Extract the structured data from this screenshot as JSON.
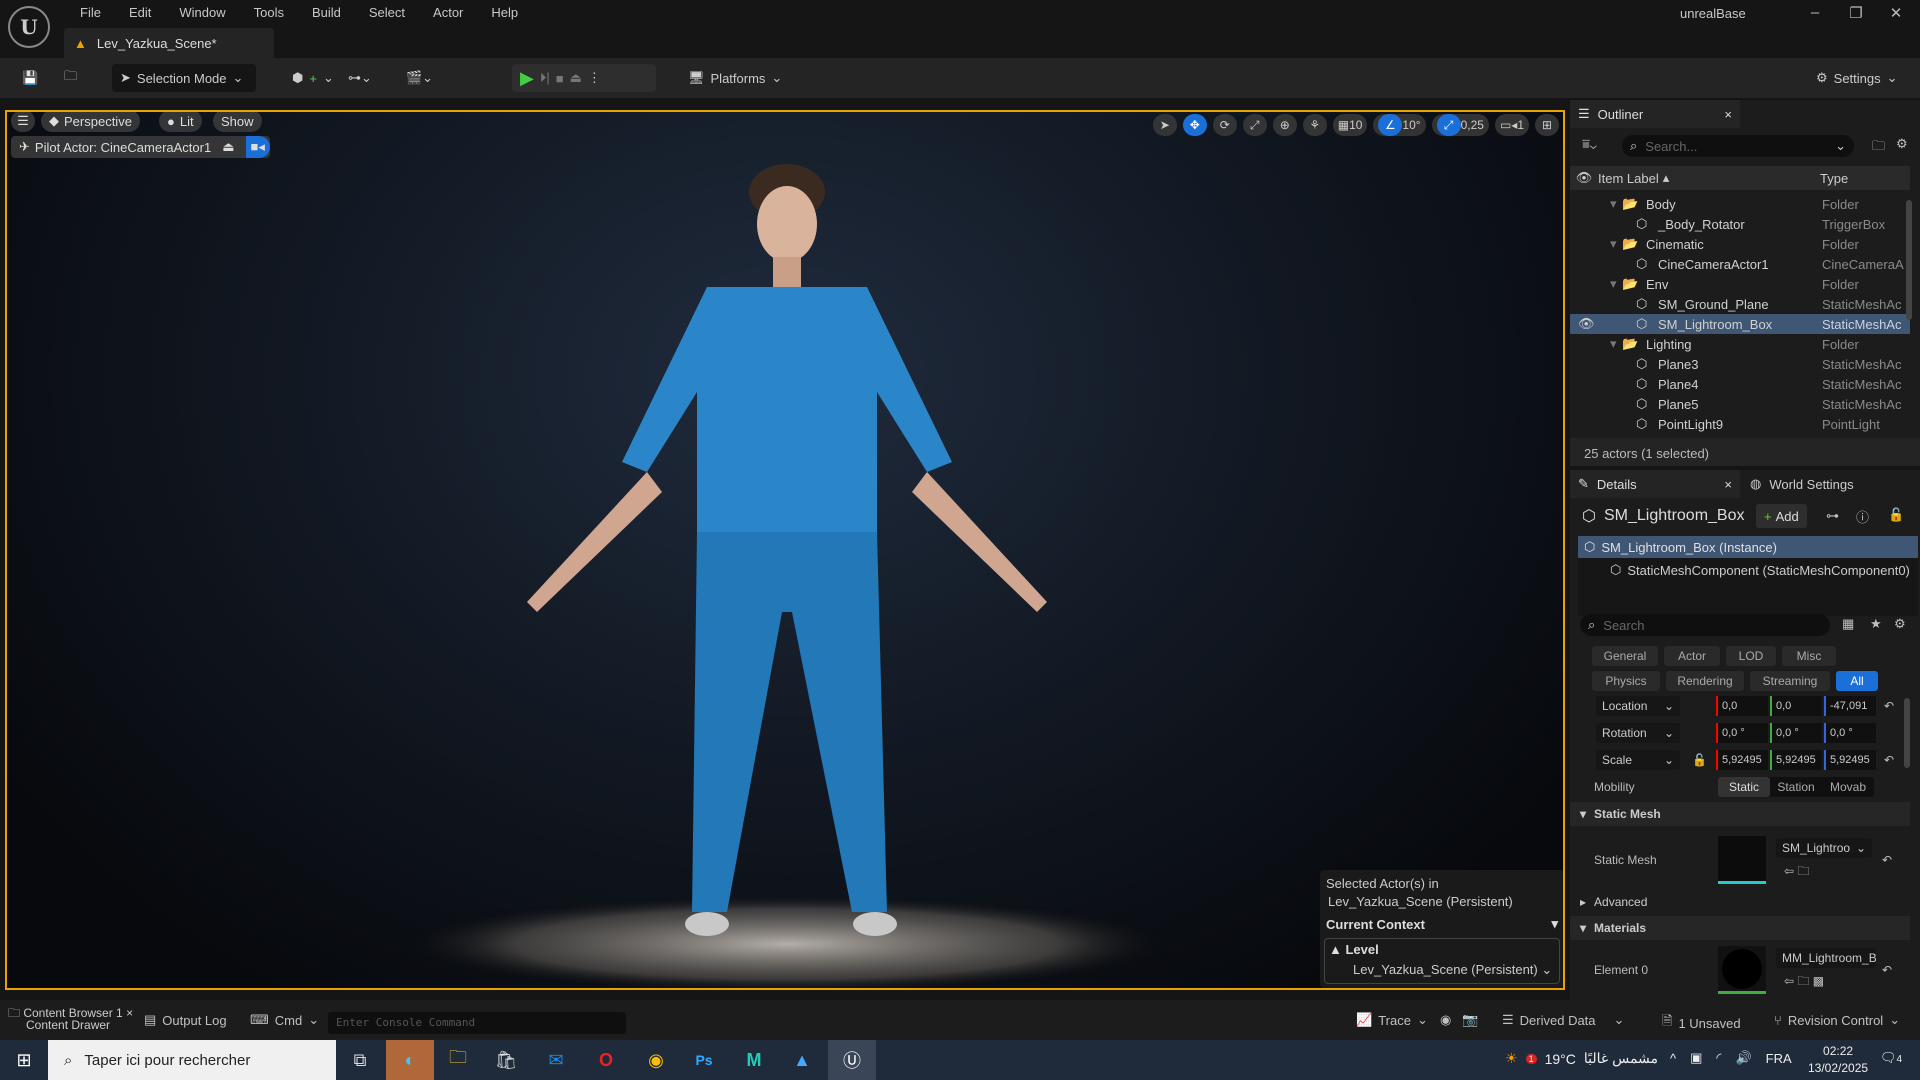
{
  "app": {
    "title": "unrealBase",
    "level_tab": "Lev_Yazkua_Scene*"
  },
  "menu": [
    "File",
    "Edit",
    "Window",
    "Tools",
    "Build",
    "Select",
    "Actor",
    "Help"
  ],
  "toolbar": {
    "selection_mode": "Selection Mode",
    "platforms": "Platforms",
    "settings": "Settings"
  },
  "viewport": {
    "perspective": "Perspective",
    "lit": "Lit",
    "show": "Show",
    "pilot": "Pilot Actor: CineCameraActor1",
    "grid_snap": "10",
    "rot_snap": "10°",
    "scale_snap": "0,25",
    "cam_speed": "1",
    "context": {
      "selected": "Selected Actor(s) in",
      "level_persistent": "Lev_Yazkua_Scene (Persistent)",
      "current_context": "Current Context",
      "level": "Level",
      "level_dropdown": "Lev_Yazkua_Scene (Persistent)"
    }
  },
  "outliner": {
    "tab": "Outliner",
    "search_placeholder": "Search...",
    "col_label": "Item Label",
    "col_type": "Type",
    "footer": "25 actors (1 selected)",
    "rows": [
      {
        "label": "Body",
        "type": "Folder",
        "folder": true
      },
      {
        "label": "_Body_Rotator",
        "type": "TriggerBox"
      },
      {
        "label": "Cinematic",
        "type": "Folder",
        "folder": true
      },
      {
        "label": "CineCameraActor1",
        "type": "CineCameraA"
      },
      {
        "label": "Env",
        "type": "Folder",
        "folder": true
      },
      {
        "label": "SM_Ground_Plane",
        "type": "StaticMeshAc"
      },
      {
        "label": "SM_Lightroom_Box",
        "type": "StaticMeshAc",
        "selected": true
      },
      {
        "label": "Lighting",
        "type": "Folder",
        "folder": true
      },
      {
        "label": "Plane3",
        "type": "StaticMeshAc"
      },
      {
        "label": "Plane4",
        "type": "StaticMeshAc"
      },
      {
        "label": "Plane5",
        "type": "StaticMeshAc"
      },
      {
        "label": "PointLight9",
        "type": "PointLight"
      }
    ]
  },
  "details": {
    "tab": "Details",
    "world_tab": "World Settings",
    "actor": "SM_Lightroom_Box",
    "add": "Add",
    "instance": "SM_Lightroom_Box (Instance)",
    "component": "StaticMeshComponent (StaticMeshComponent0)",
    "search_placeholder": "Search",
    "filters1": [
      "General",
      "Actor",
      "LOD",
      "Misc"
    ],
    "filters2": [
      "Physics",
      "Rendering",
      "Streaming",
      "All"
    ],
    "location": {
      "label": "Location",
      "x": "0,0",
      "y": "0,0",
      "z": "-47,091"
    },
    "rotation": {
      "label": "Rotation",
      "x": "0,0 °",
      "y": "0,0 °",
      "z": "0,0 °"
    },
    "scale": {
      "label": "Scale",
      "x": "5,92495",
      "y": "5,92495",
      "z": "5,92495"
    },
    "mobility": {
      "label": "Mobility",
      "options": [
        "Static",
        "Station",
        "Movab"
      ]
    },
    "static_mesh_section": "Static Mesh",
    "static_mesh_label": "Static Mesh",
    "static_mesh_value": "SM_Lightroo",
    "advanced": "Advanced",
    "materials": "Materials",
    "element0": "Element 0",
    "material_value": "MM_Lightroom_Bo"
  },
  "bottom": {
    "content_browser": "Content Browser 1",
    "content_drawer": "Content Drawer",
    "output_log": "Output Log",
    "cmd": "Cmd",
    "console_placeholder": "Enter Console Command",
    "trace": "Trace",
    "derived": "Derived Data",
    "unsaved": "1 Unsaved",
    "revision": "Revision Control"
  },
  "taskbar": {
    "search": "Taper ici pour rechercher",
    "weather": "19°C",
    "weather_text": "مشمس غالبًا",
    "lang": "FRA",
    "time": "02:22",
    "date": "13/02/2025",
    "notif": "4",
    "weather_badge": "1"
  },
  "colors": {
    "accent": "#1a6fd8",
    "viewport_border": "#e8a300",
    "scrubs": "#2a86c8"
  }
}
